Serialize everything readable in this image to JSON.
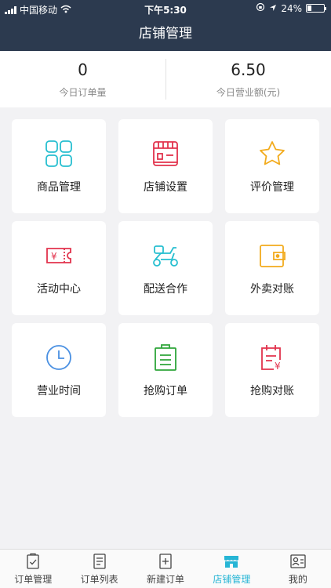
{
  "status": {
    "carrier": "中国移动",
    "time": "下午5:30",
    "battery": "24%",
    "battery_level": 0.24
  },
  "header": {
    "title": "店铺管理"
  },
  "stats": [
    {
      "value": "0",
      "label": "今日订单量"
    },
    {
      "value": "6.50",
      "label": "今日营业额(元)"
    }
  ],
  "tiles": [
    {
      "label": "商品管理",
      "icon": "four-squares-icon",
      "color": "#27bfd0"
    },
    {
      "label": "店铺设置",
      "icon": "storefront-icon",
      "color": "#e2334d"
    },
    {
      "label": "评价管理",
      "icon": "star-icon",
      "color": "#f2ab1d"
    },
    {
      "label": "活动中心",
      "icon": "ticket-icon",
      "color": "#e2334d"
    },
    {
      "label": "配送合作",
      "icon": "scooter-icon",
      "color": "#27bfd0"
    },
    {
      "label": "外卖对账",
      "icon": "wallet-icon",
      "color": "#f2ab1d"
    },
    {
      "label": "营业时间",
      "icon": "clock-icon",
      "color": "#4a90e2"
    },
    {
      "label": "抢购订单",
      "icon": "clipboard-icon",
      "color": "#2ea53a"
    },
    {
      "label": "抢购对账",
      "icon": "calendar-yen-icon",
      "color": "#e2334d"
    }
  ],
  "tabs": [
    {
      "label": "订单管理",
      "icon": "clipboard-check-icon",
      "active": false
    },
    {
      "label": "订单列表",
      "icon": "document-list-icon",
      "active": false
    },
    {
      "label": "新建订单",
      "icon": "add-document-icon",
      "active": false
    },
    {
      "label": "店铺管理",
      "icon": "store-icon",
      "active": true
    },
    {
      "label": "我的",
      "icon": "profile-card-icon",
      "active": false
    }
  ],
  "colors": {
    "header_bg": "#2c3a4f",
    "accent": "#26b5d5"
  }
}
